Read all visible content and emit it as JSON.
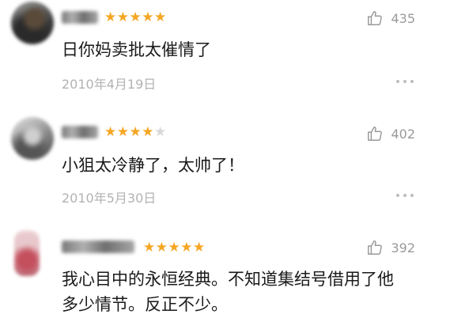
{
  "comments": [
    {
      "rating": 5,
      "likes": "435",
      "text": "日你妈卖批太催情了",
      "date": "2010年4月19日"
    },
    {
      "rating": 4,
      "likes": "402",
      "text": "小狙太冷静了，太帅了！",
      "date": "2010年5月30日"
    },
    {
      "rating": 5,
      "likes": "392",
      "text": "我心目中的永恒经典。不知道集结号借用了他多少情节。反正不少。",
      "date": ""
    }
  ],
  "rating_max": 5,
  "colors": {
    "star_on": "#f5a623",
    "star_off": "#d8d8d8",
    "meta_gray": "#9a9a9a",
    "date_gray": "#b2b2b2"
  },
  "icons": {
    "like": "thumbs-up-icon",
    "more": "more-dots-icon"
  }
}
